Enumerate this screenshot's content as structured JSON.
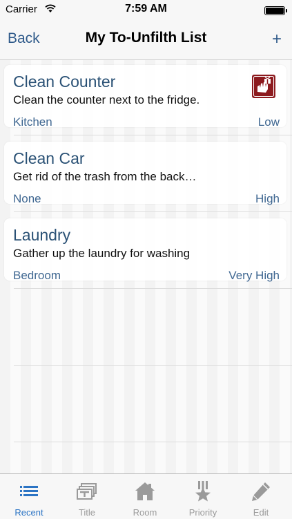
{
  "status_bar": {
    "carrier": "Carrier",
    "time": "7:59 AM",
    "battery_level": 1.0
  },
  "nav": {
    "back_label": "Back",
    "title": "My To-Unfilth List",
    "add_label": "+"
  },
  "tasks": [
    {
      "title": "Clean Counter",
      "description": "Clean the counter next to the fridge.",
      "room": "Kitchen",
      "priority": "Low",
      "icon": "hand-gift-icon"
    },
    {
      "title": "Clean Car",
      "description": "Get rid of the trash from the back…",
      "room": "None",
      "priority": "High"
    },
    {
      "title": "Laundry",
      "description": "Gather up the laundry for washing",
      "room": "Bedroom",
      "priority": "Very High"
    }
  ],
  "tabs": [
    {
      "label": "Recent",
      "icon": "list-icon",
      "active": true
    },
    {
      "label": "Title",
      "icon": "title-icon",
      "active": false
    },
    {
      "label": "Room",
      "icon": "house-icon",
      "active": false
    },
    {
      "label": "Priority",
      "icon": "star-medal-icon",
      "active": false
    },
    {
      "label": "Edit",
      "icon": "pencil-icon",
      "active": false
    }
  ],
  "colors": {
    "accent": "#2b74c4",
    "title_text": "#2a5175",
    "link": "#3f6791",
    "icon_bg": "#8c1a1e"
  }
}
